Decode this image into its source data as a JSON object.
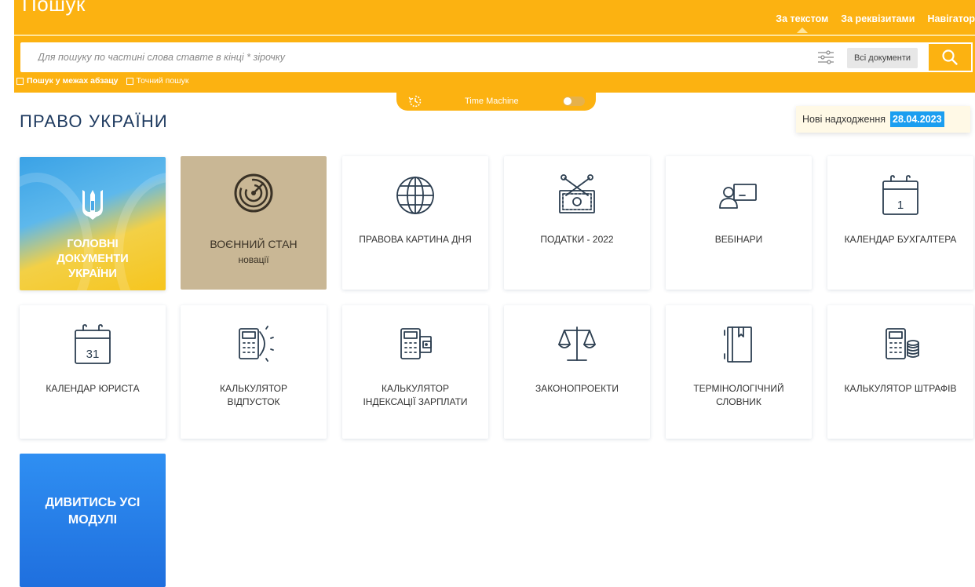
{
  "search": {
    "title": "Пошук",
    "tabs": [
      "За текстом",
      "За реквізитами",
      "Навігатор"
    ],
    "placeholder": "Для пошуку по частині слова ставте в кінці * зірочку",
    "scope": "Всі документи",
    "options": [
      "Пошук у межах абзацу",
      "Точний пошук"
    ]
  },
  "time_machine": {
    "label": "Time Machine",
    "enabled": false
  },
  "page": {
    "title": "ПРАВО УКРАЇНИ",
    "news_label": "Нові надходження",
    "news_date": "28.04.2023"
  },
  "tiles": {
    "main_docs": [
      "ГОЛОВНІ",
      "ДОКУМЕНТИ",
      "УКРАЇНИ"
    ],
    "war": {
      "title": "ВОЄННИЙ СТАН",
      "subtitle": "новації"
    },
    "legal_picture": "ПРАВОВА КАРТИНА ДНЯ",
    "taxes": "ПОДАТКИ - 2022",
    "webinars": "ВЕБІНАРИ",
    "accountant_calendar": {
      "label": "КАЛЕНДАР БУХГАЛТЕРА",
      "day": "1"
    },
    "lawyer_calendar": {
      "label": "КАЛЕНДАР ЮРИСТА",
      "day": "31"
    },
    "vacation_calc": [
      "КАЛЬКУЛЯТОР",
      "ВІДПУСТОК"
    ],
    "salary_index_calc": [
      "КАЛЬКУЛЯТОР",
      "ІНДЕКСАЦІЇ ЗАРПЛАТИ"
    ],
    "bills": "ЗАКОНОПРОЕКТИ",
    "glossary": [
      "ТЕРМІНОЛОГІЧНИЙ",
      "СЛОВНИК"
    ],
    "fines_calc": "КАЛЬКУЛЯТОР ШТРАФІВ",
    "all_modules": [
      "ДИВИТИСЬ УСІ",
      "МОДУЛІ"
    ]
  },
  "colors": {
    "search_band": "#fcb211",
    "title": "#1e3a5f",
    "news_date_bg": "#1b9ef0",
    "war_tile": "#c9b795",
    "all_modules_tile": "#2f8ff2"
  }
}
